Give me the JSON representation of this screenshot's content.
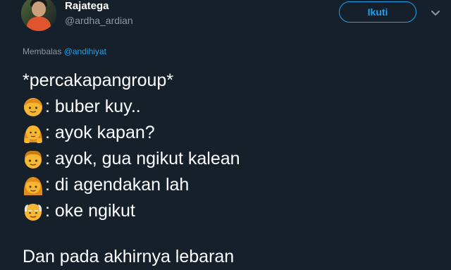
{
  "profile": {
    "name": "Rajatega",
    "handle": "@ardha_ardian",
    "follow_label": "Ikuti"
  },
  "reply": {
    "prefix": "Membalas",
    "mention": "@andihiyat"
  },
  "tweet": {
    "title": "*percakapangroup*",
    "lines": [
      ": buber kuy..",
      ": ayok kapan?",
      ": ayok, gua ngikut kalean",
      ": di agendakan lah",
      ": oke ngikut"
    ],
    "footer": "Dan pada akhirnya lebaran"
  },
  "icons": {
    "caret": "chevron-down-icon",
    "emoji_1": "boy-emoji",
    "emoji_2": "woman-gesturing-emoji",
    "emoji_3": "man-emoji",
    "emoji_4": "woman-emoji",
    "emoji_5": "old-man-emoji"
  },
  "colors": {
    "background": "#15202b",
    "accent": "#1da1f2",
    "secondary_text": "#8899a6",
    "emoji_skin": "#f7b733"
  }
}
